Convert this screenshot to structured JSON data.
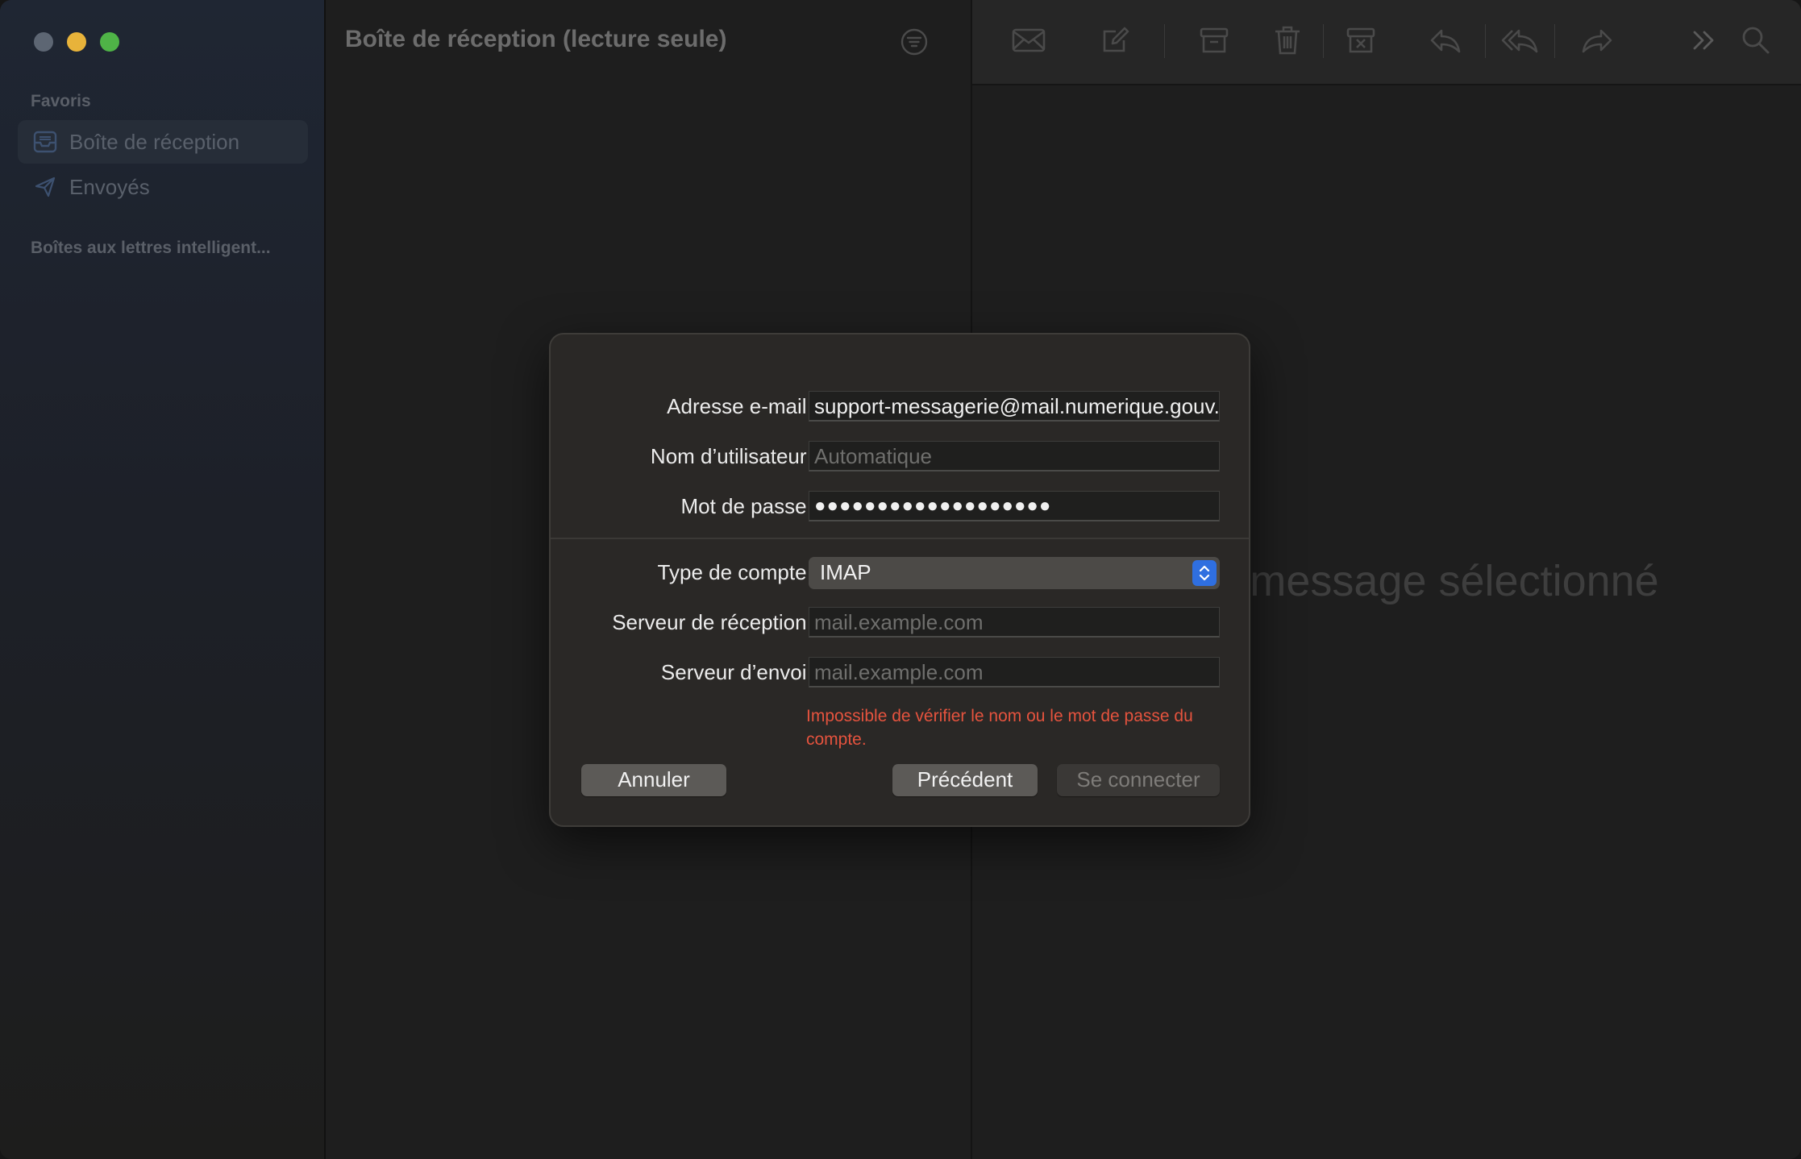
{
  "sidebar": {
    "favorites_heading": "Favoris",
    "items": [
      {
        "label": "Boîte de réception",
        "icon": "inbox-icon"
      },
      {
        "label": "Envoyés",
        "icon": "paper-plane-icon"
      }
    ],
    "smart_heading": "Boîtes aux lettres intelligent..."
  },
  "list": {
    "title": "Boîte de réception (lecture seule)"
  },
  "toolbar": {
    "icons": [
      "envelope-icon",
      "compose-icon",
      "archive-icon",
      "trash-icon",
      "junk-icon",
      "reply-icon",
      "reply-all-icon",
      "forward-icon",
      "more-icon",
      "search-icon"
    ]
  },
  "message_pane": {
    "empty_text": "Aucun message sélectionné"
  },
  "dialog": {
    "email_label": "Adresse e-mail :",
    "email_value": "support-messagerie@mail.numerique.gouv.fr",
    "username_label": "Nom d’utilisateur :",
    "username_placeholder": "Automatique",
    "password_label": "Mot de passe :",
    "password_mask": "●●●●●●●●●●●●●●●●●●●",
    "account_type_label": "Type de compte :",
    "account_type_value": "IMAP",
    "incoming_label": "Serveur de réception :",
    "incoming_placeholder": "mail.example.com",
    "outgoing_label": "Serveur d’envoi :",
    "outgoing_placeholder": "mail.example.com",
    "error_text": "Impossible de vérifier le nom ou le mot de passe du compte.",
    "cancel_label": "Annuler",
    "back_label": "Précédent",
    "connect_label": "Se connecter"
  },
  "colors": {
    "accent": "#2f6fe0",
    "error": "#e5533e",
    "close": "#5d6673",
    "minimize": "#e8b33a",
    "maximize": "#4fb347"
  }
}
